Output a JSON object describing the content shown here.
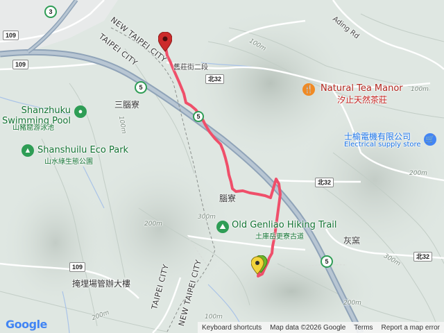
{
  "labels": {
    "new_taipei_city_top": "NEW TAIPEI CITY",
    "taipei_city_top": "TAIPEI CITY",
    "taipei_city_left": "TAIPEI CITY",
    "new_taipei_city_left": "NEW TAIPEI CITY",
    "ding_rd": "Ading Rd",
    "jiuzhuang": "舊莊街二段",
    "sannaoliao": "三腦寮",
    "naoliao": "腦寮",
    "huiyao": "灰窯",
    "yanmai": "掩埋場管辦大樓"
  },
  "pois": {
    "shanzhuku_pool": "Shanzhuku Swimming Pool",
    "shanzhuku_pool_zh": "山豬窟游泳池",
    "shanshuilu": "Shanshuilu Eco Park",
    "shanshuilu_zh": "山水綠生態公園",
    "natural_tea": "Natural Tea Manor",
    "natural_tea_zh": "汐止天然茶莊",
    "electrical": "士榆電機有限公司",
    "electrical_en": "Electrical supply store",
    "genliao": "Old Genliao Hiking Trail",
    "genliao_zh": "土庫岳更寮古道"
  },
  "shields": {
    "r3": "3",
    "r109a": "109",
    "r109b": "109",
    "r109c": "109",
    "r5a": "5",
    "r5b": "5",
    "r5c": "5",
    "north32a": "北32",
    "north32b": "北32",
    "north32c": "北32"
  },
  "contours": {
    "c100a": "100m",
    "c100b": "100m",
    "c100c": "100m",
    "c200a": "200m",
    "c200b": "200m",
    "c300a": "300m",
    "c300b": "300m",
    "c200c": "200m",
    "c100d": "100m",
    "c200d": "200m"
  },
  "footer": {
    "shortcuts": "Keyboard shortcuts",
    "data": "Map data ©2026 Google",
    "terms": "Terms",
    "report": "Report a map error"
  },
  "logo": "Google",
  "colors": {
    "track": "#ef4f6a",
    "highway": "#8fa3b8",
    "road": "#ffffff",
    "start_pin": "#6bb82c",
    "end_pin": "#cc2b2b"
  }
}
